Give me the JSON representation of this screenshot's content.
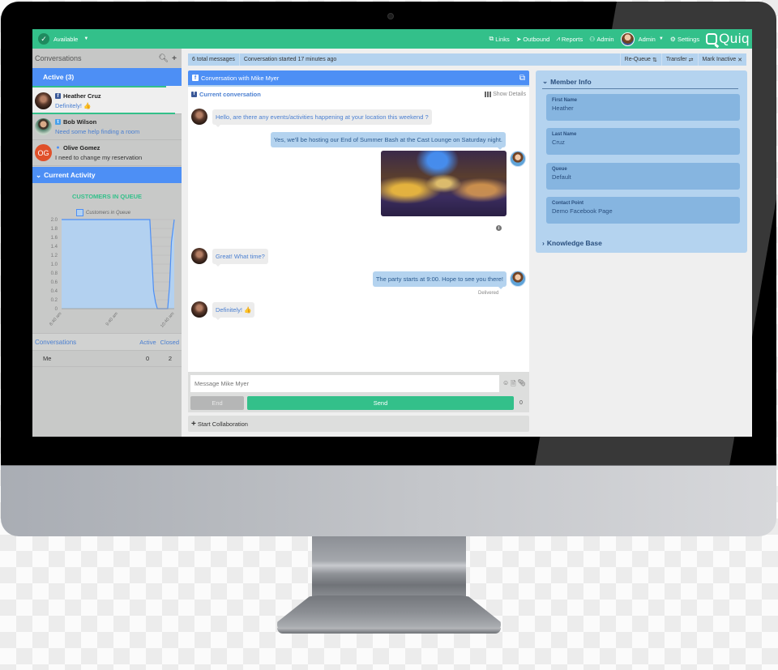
{
  "topbar": {
    "status": "Available",
    "nav": [
      {
        "icon": "external-link-icon",
        "glyph": "⧉",
        "label": "Links"
      },
      {
        "icon": "paper-plane-icon",
        "glyph": "➤",
        "label": "Outbound"
      },
      {
        "icon": "line-chart-icon",
        "glyph": "📈",
        "label": "Reports"
      },
      {
        "icon": "users-icon",
        "glyph": "☘",
        "label": "Admin"
      }
    ],
    "user_label": "Admin",
    "settings_label": "Settings",
    "brand": "Quiq"
  },
  "sidebar": {
    "title": "Conversations",
    "active_label": "Active (3)",
    "conversations": [
      {
        "name": "Heather Cruz",
        "channel": "facebook",
        "channel_glyph": "f",
        "preview": "Definitely! 👍",
        "avatar_text": ""
      },
      {
        "name": "Bob Wilson",
        "channel": "twitter",
        "channel_glyph": "t",
        "preview": "Need some help finding a room",
        "avatar_text": ""
      },
      {
        "name": "Olive Gomez",
        "channel": "apple",
        "channel_glyph": "",
        "preview": "I need to change my reservation",
        "avatar_text": "OG"
      }
    ],
    "current_activity_label": "Current Activity",
    "stats": {
      "title": "Conversations",
      "col_active": "Active",
      "col_closed": "Closed",
      "rows": [
        {
          "label": "Me",
          "active": "0",
          "closed": "2"
        }
      ]
    }
  },
  "chart_data": {
    "type": "area",
    "title": "CUSTOMERS IN QUEUE",
    "legend": [
      "Customers in Queue"
    ],
    "legend_position": "top-center",
    "xlabel": "",
    "ylabel": "",
    "ylim": [
      0,
      2.0
    ],
    "yticks": [
      0,
      0.2,
      0.4,
      0.6,
      0.8,
      1.0,
      1.2,
      1.4,
      1.6,
      1.8,
      2.0
    ],
    "ytick_labels": [
      "0",
      "0.2",
      "0.4",
      "0.6",
      "0.8",
      "1.0",
      "1.2",
      "1.4",
      "1.6",
      "1.8",
      "2.0"
    ],
    "xtick_labels": [
      "8:40 am",
      "9:40 am",
      "10:40 am"
    ],
    "xlim_minutes": [
      0,
      120
    ],
    "series": [
      {
        "name": "Customers in Queue",
        "x_minutes": [
          0,
          94,
          96,
          98,
          100,
          102,
          104,
          113,
          115,
          117,
          120
        ],
        "values": [
          2,
          2,
          1.2,
          0.4,
          0.15,
          0,
          0,
          0,
          0.5,
          1.5,
          2
        ]
      }
    ],
    "grid": true,
    "colors": {
      "line": "#4d8ff5",
      "fill": "#b3d1f0"
    }
  },
  "infobar": {
    "total_messages": "6 total messages",
    "started": "Conversation started 17 minutes ago",
    "requeue": "Re-Queue",
    "transfer": "Transfer",
    "mark_inactive": "Mark Inactive"
  },
  "conversation": {
    "title": "Conversation with Mike Myer",
    "current_label": "Current conversation",
    "show_details": "Show Details",
    "messages": [
      {
        "direction": "in",
        "text": "Hello, are there any events/activities happening at your location this weekend ?"
      },
      {
        "direction": "out",
        "text": "Yes, we'll be hosting our End of Summer Bash at the Cast Lounge on Saturday night."
      },
      {
        "direction": "out",
        "type": "image",
        "text": ""
      },
      {
        "direction": "in",
        "text": "Great! What time?"
      },
      {
        "direction": "out",
        "text": "The party starts at 9:00.  Hope to see you there!",
        "status": "Delivered"
      },
      {
        "direction": "in",
        "text": "Definitely! 👍"
      }
    ]
  },
  "compose": {
    "placeholder": "Message Mike Myer",
    "end_label": "End",
    "send_label": "Send",
    "char_count": "0",
    "collab_label": "Start Collaboration"
  },
  "member_info": {
    "title": "Member Info",
    "fields": [
      {
        "label": "First Name",
        "value": "Heather"
      },
      {
        "label": "Last Name",
        "value": "Cruz"
      },
      {
        "label": "Queue",
        "value": "Default"
      },
      {
        "label": "Contact Point",
        "value": "Demo Facebook Page"
      }
    ],
    "knowledge_base": "Knowledge Base"
  },
  "colors": {
    "brand_green": "#33c08a",
    "accent_blue": "#4d8ff5",
    "light_blue": "#b4d3ef",
    "field_blue": "#86b5e0"
  }
}
